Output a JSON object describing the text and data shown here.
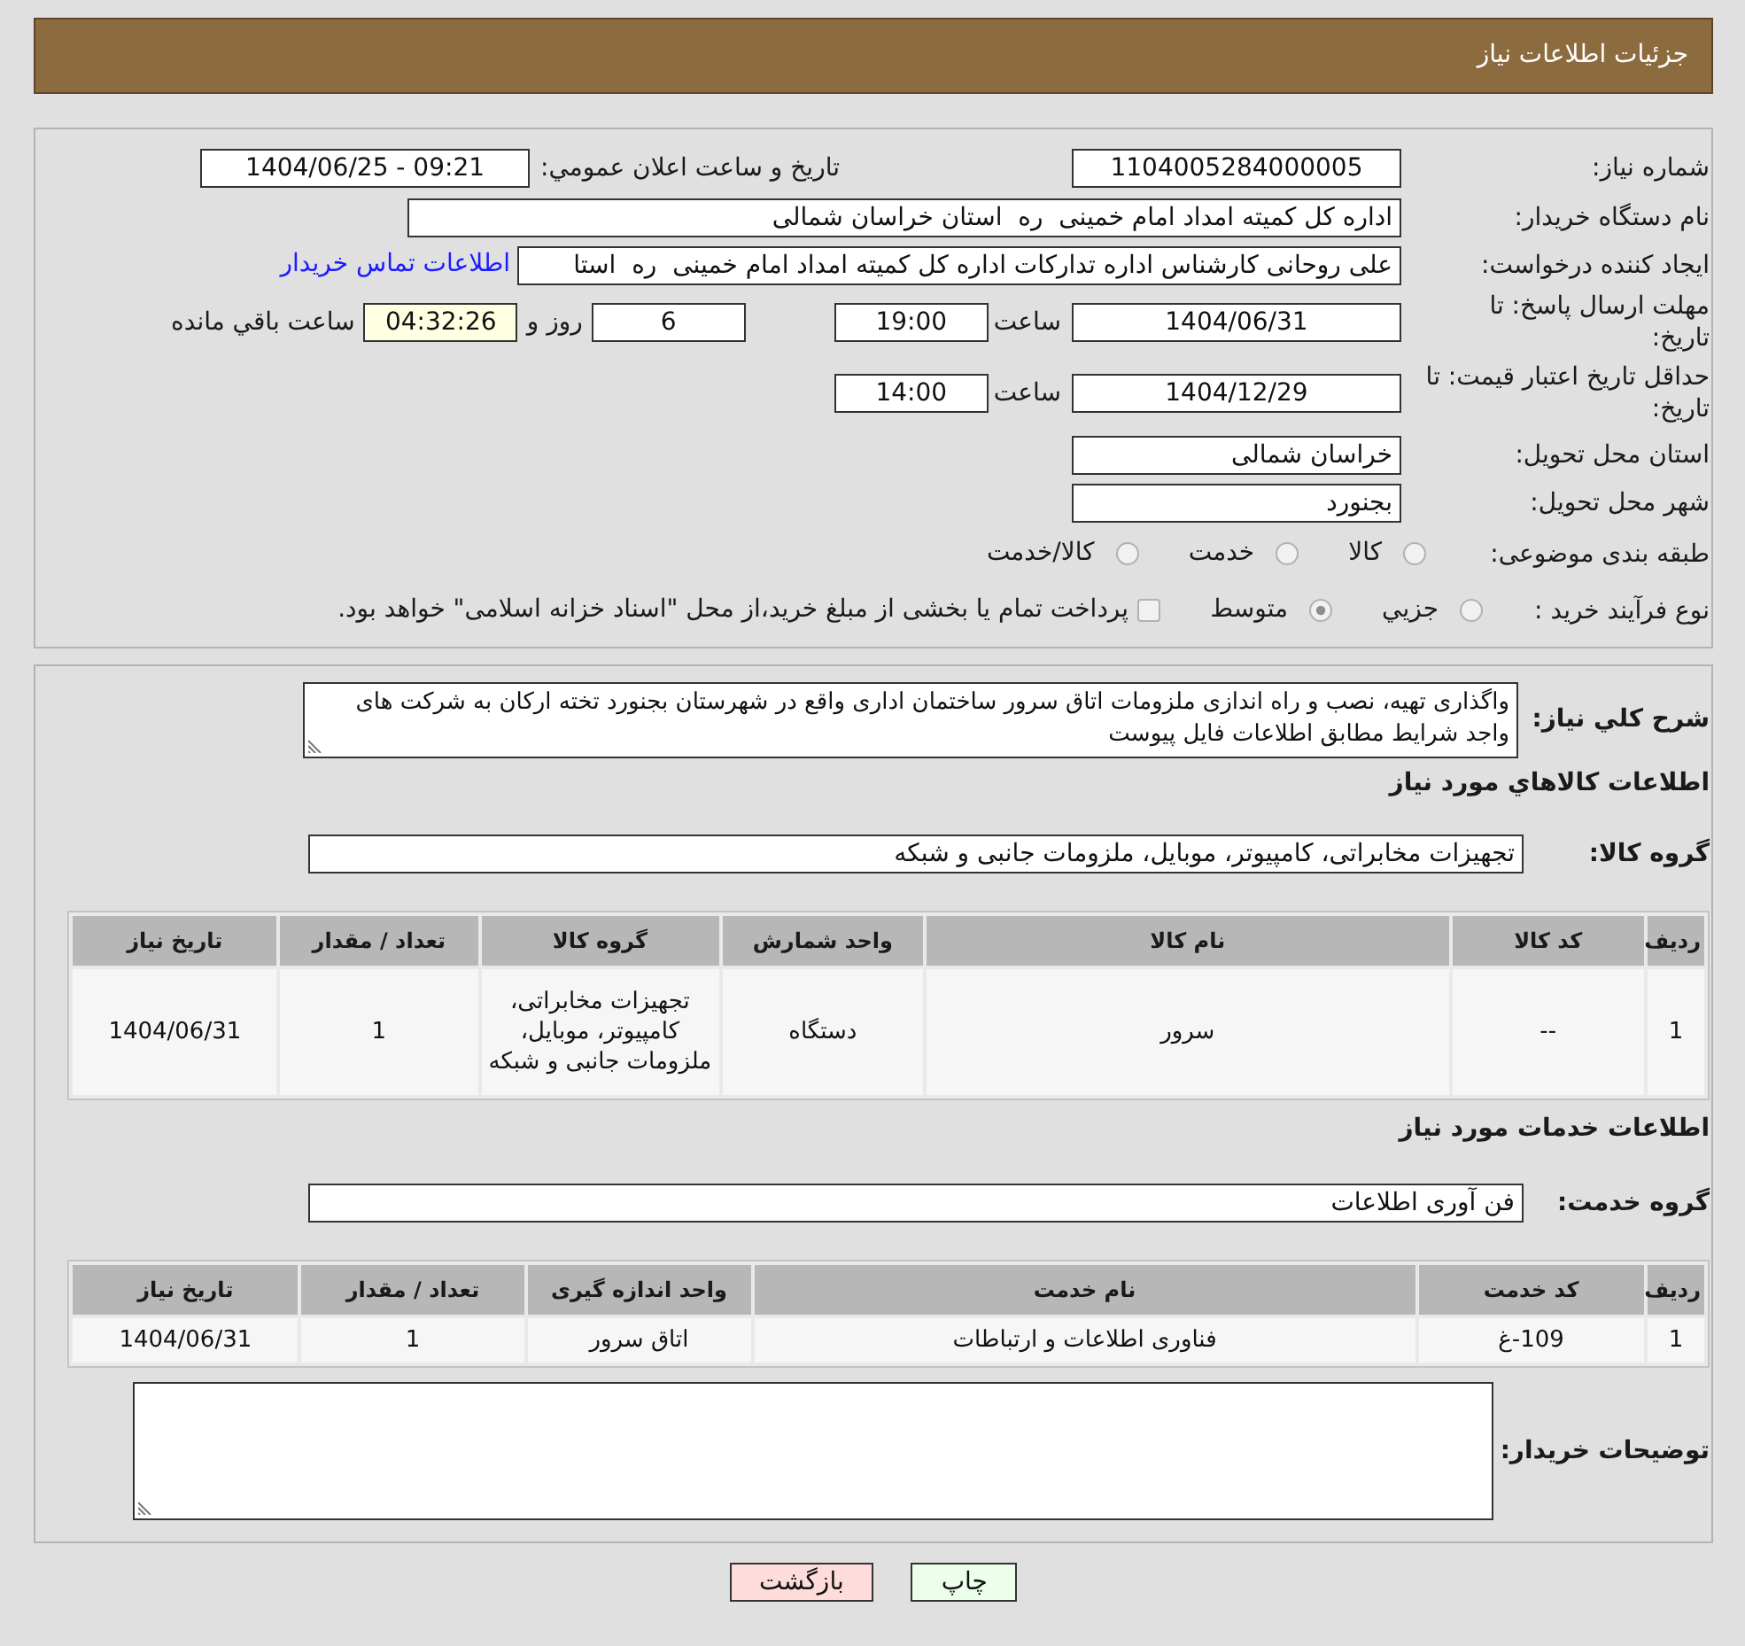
{
  "header": {
    "title": "جزئیات اطلاعات نیاز"
  },
  "summary": {
    "need_number": {
      "label": "شماره نیاز:",
      "value": "1104005284000005"
    },
    "announcement": {
      "label": "تاریخ و ساعت اعلان عمومي:",
      "value": "1404/06/25 - 09:21"
    },
    "buyer_org": {
      "label": "نام دستگاه خریدار:",
      "value": "اداره کل کمیته امداد امام خمینی  ره  استان خراسان شمالی"
    },
    "requester": {
      "label": "ایجاد کننده درخواست:",
      "value": "علی روحانی کارشناس اداره تدارکات اداره کل کمیته امداد امام خمینی  ره  استا",
      "contact_link": "اطلاعات تماس خریدار"
    },
    "reply_deadline": {
      "label": "مهلت ارسال پاسخ: تا تاریخ:",
      "date": "1404/06/31",
      "time_label": "ساعت",
      "time": "19:00",
      "days": "6",
      "days_label": "روز و",
      "remaining": "04:32:26",
      "remaining_label": "ساعت باقي مانده"
    },
    "price_validity": {
      "label": "حداقل تاریخ اعتبار قیمت: تا تاریخ:",
      "date": "1404/12/29",
      "time_label": "ساعت",
      "time": "14:00"
    },
    "delivery_province": {
      "label": "استان محل تحویل:",
      "value": "خراسان شمالی"
    },
    "delivery_city": {
      "label": "شهر محل تحویل:",
      "value": "بجنورد"
    },
    "category": {
      "label": "طبقه بندی موضوعی:",
      "options": [
        {
          "label": "کالا",
          "selected": false
        },
        {
          "label": "خدمت",
          "selected": false
        },
        {
          "label": "کالا/خدمت",
          "selected": false
        }
      ]
    },
    "purchase_process": {
      "label": "نوع فرآیند خرید :",
      "options": [
        {
          "label": "جزيي",
          "selected": false
        },
        {
          "label": "متوسط",
          "selected": true
        }
      ],
      "treasury_option": {
        "label": "پرداخت تمام یا بخشی از مبلغ خرید،از محل \"اسناد خزانه اسلامی\" خواهد بود.",
        "checked": false
      }
    }
  },
  "details": {
    "description": {
      "label": "شرح کلي نیاز:",
      "value": "واگذاری تهیه، نصب و راه اندازی ملزومات اتاق سرور ساختمان اداری واقع در شهرستان بجنورد تخته ارکان به شرکت های واجد شرایط مطابق اطلاعات فایل پیوست"
    },
    "goods_heading": "اطلاعات کالاهاي مورد نیاز",
    "goods_group": {
      "label": "گروه کالا:",
      "value": "تجهیزات مخابراتی، کامپیوتر، موبایل، ملزومات جانبی و شبکه"
    },
    "goods_table": {
      "columns": [
        "ردیف",
        "کد کالا",
        "نام کالا",
        "واحد شمارش",
        "گروه کالا",
        "تعداد / مقدار",
        "تاریخ نیاز"
      ],
      "rows": [
        [
          "1",
          "--",
          "سرور",
          "دستگاه",
          "تجهیزات مخابراتی، کامپیوتر، موبایل، ملزومات جانبی و شبکه",
          "1",
          "1404/06/31"
        ]
      ]
    },
    "services_heading": "اطلاعات خدمات مورد نیاز",
    "service_group": {
      "label": "گروه خدمت:",
      "value": "فن آوری اطلاعات"
    },
    "services_table": {
      "columns": [
        "ردیف",
        "کد خدمت",
        "نام خدمت",
        "واحد اندازه گیری",
        "تعداد / مقدار",
        "تاریخ نیاز"
      ],
      "rows": [
        [
          "1",
          "109-غ",
          "فناوری اطلاعات و ارتباطات",
          "اتاق سرور",
          "1",
          "1404/06/31"
        ]
      ]
    },
    "buyer_notes": {
      "label": "توضیحات خریدار:"
    }
  },
  "buttons": [
    {
      "label": "چاپ",
      "kind": "print"
    },
    {
      "label": "بازگشت",
      "kind": "back"
    }
  ]
}
